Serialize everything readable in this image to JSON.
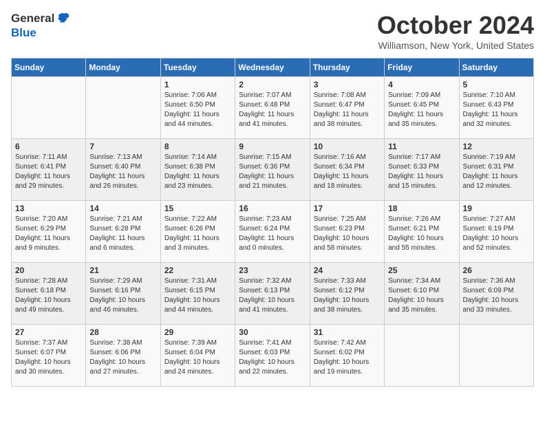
{
  "header": {
    "logo_general": "General",
    "logo_blue": "Blue",
    "month": "October 2024",
    "location": "Williamson, New York, United States"
  },
  "days_of_week": [
    "Sunday",
    "Monday",
    "Tuesday",
    "Wednesday",
    "Thursday",
    "Friday",
    "Saturday"
  ],
  "weeks": [
    [
      {
        "day": "",
        "info": ""
      },
      {
        "day": "",
        "info": ""
      },
      {
        "day": "1",
        "info": "Sunrise: 7:06 AM\nSunset: 6:50 PM\nDaylight: 11 hours and 44 minutes."
      },
      {
        "day": "2",
        "info": "Sunrise: 7:07 AM\nSunset: 6:48 PM\nDaylight: 11 hours and 41 minutes."
      },
      {
        "day": "3",
        "info": "Sunrise: 7:08 AM\nSunset: 6:47 PM\nDaylight: 11 hours and 38 minutes."
      },
      {
        "day": "4",
        "info": "Sunrise: 7:09 AM\nSunset: 6:45 PM\nDaylight: 11 hours and 35 minutes."
      },
      {
        "day": "5",
        "info": "Sunrise: 7:10 AM\nSunset: 6:43 PM\nDaylight: 11 hours and 32 minutes."
      }
    ],
    [
      {
        "day": "6",
        "info": "Sunrise: 7:11 AM\nSunset: 6:41 PM\nDaylight: 11 hours and 29 minutes."
      },
      {
        "day": "7",
        "info": "Sunrise: 7:13 AM\nSunset: 6:40 PM\nDaylight: 11 hours and 26 minutes."
      },
      {
        "day": "8",
        "info": "Sunrise: 7:14 AM\nSunset: 6:38 PM\nDaylight: 11 hours and 23 minutes."
      },
      {
        "day": "9",
        "info": "Sunrise: 7:15 AM\nSunset: 6:36 PM\nDaylight: 11 hours and 21 minutes."
      },
      {
        "day": "10",
        "info": "Sunrise: 7:16 AM\nSunset: 6:34 PM\nDaylight: 11 hours and 18 minutes."
      },
      {
        "day": "11",
        "info": "Sunrise: 7:17 AM\nSunset: 6:33 PM\nDaylight: 11 hours and 15 minutes."
      },
      {
        "day": "12",
        "info": "Sunrise: 7:19 AM\nSunset: 6:31 PM\nDaylight: 11 hours and 12 minutes."
      }
    ],
    [
      {
        "day": "13",
        "info": "Sunrise: 7:20 AM\nSunset: 6:29 PM\nDaylight: 11 hours and 9 minutes."
      },
      {
        "day": "14",
        "info": "Sunrise: 7:21 AM\nSunset: 6:28 PM\nDaylight: 11 hours and 6 minutes."
      },
      {
        "day": "15",
        "info": "Sunrise: 7:22 AM\nSunset: 6:26 PM\nDaylight: 11 hours and 3 minutes."
      },
      {
        "day": "16",
        "info": "Sunrise: 7:23 AM\nSunset: 6:24 PM\nDaylight: 11 hours and 0 minutes."
      },
      {
        "day": "17",
        "info": "Sunrise: 7:25 AM\nSunset: 6:23 PM\nDaylight: 10 hours and 58 minutes."
      },
      {
        "day": "18",
        "info": "Sunrise: 7:26 AM\nSunset: 6:21 PM\nDaylight: 10 hours and 55 minutes."
      },
      {
        "day": "19",
        "info": "Sunrise: 7:27 AM\nSunset: 6:19 PM\nDaylight: 10 hours and 52 minutes."
      }
    ],
    [
      {
        "day": "20",
        "info": "Sunrise: 7:28 AM\nSunset: 6:18 PM\nDaylight: 10 hours and 49 minutes."
      },
      {
        "day": "21",
        "info": "Sunrise: 7:29 AM\nSunset: 6:16 PM\nDaylight: 10 hours and 46 minutes."
      },
      {
        "day": "22",
        "info": "Sunrise: 7:31 AM\nSunset: 6:15 PM\nDaylight: 10 hours and 44 minutes."
      },
      {
        "day": "23",
        "info": "Sunrise: 7:32 AM\nSunset: 6:13 PM\nDaylight: 10 hours and 41 minutes."
      },
      {
        "day": "24",
        "info": "Sunrise: 7:33 AM\nSunset: 6:12 PM\nDaylight: 10 hours and 38 minutes."
      },
      {
        "day": "25",
        "info": "Sunrise: 7:34 AM\nSunset: 6:10 PM\nDaylight: 10 hours and 35 minutes."
      },
      {
        "day": "26",
        "info": "Sunrise: 7:36 AM\nSunset: 6:09 PM\nDaylight: 10 hours and 33 minutes."
      }
    ],
    [
      {
        "day": "27",
        "info": "Sunrise: 7:37 AM\nSunset: 6:07 PM\nDaylight: 10 hours and 30 minutes."
      },
      {
        "day": "28",
        "info": "Sunrise: 7:38 AM\nSunset: 6:06 PM\nDaylight: 10 hours and 27 minutes."
      },
      {
        "day": "29",
        "info": "Sunrise: 7:39 AM\nSunset: 6:04 PM\nDaylight: 10 hours and 24 minutes."
      },
      {
        "day": "30",
        "info": "Sunrise: 7:41 AM\nSunset: 6:03 PM\nDaylight: 10 hours and 22 minutes."
      },
      {
        "day": "31",
        "info": "Sunrise: 7:42 AM\nSunset: 6:02 PM\nDaylight: 10 hours and 19 minutes."
      },
      {
        "day": "",
        "info": ""
      },
      {
        "day": "",
        "info": ""
      }
    ]
  ]
}
